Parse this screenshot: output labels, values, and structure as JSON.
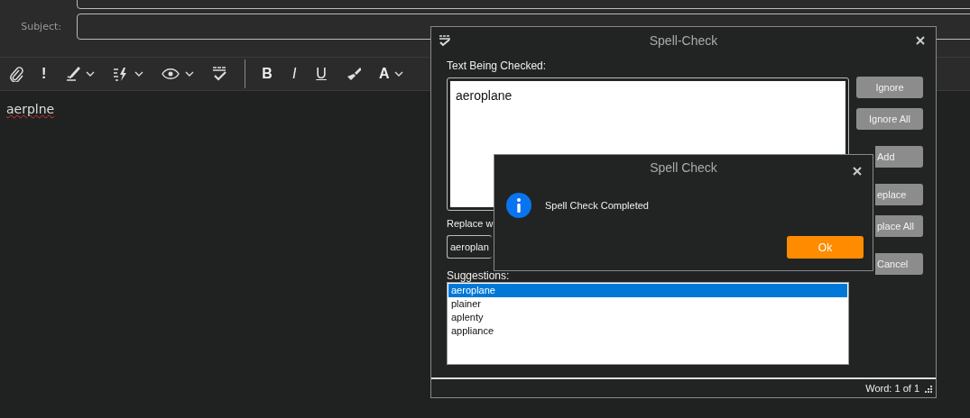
{
  "compose": {
    "subject_label": "Subject:",
    "toolbar": {
      "important": "!",
      "bold": "B",
      "italic": "I",
      "underline": "U",
      "font_color": "A"
    },
    "body_text": "aerplne",
    "body_misspelled": true
  },
  "spell_dialog": {
    "title": "Spell-Check",
    "text_label": "Text Being Checked:",
    "text_value": "aeroplane",
    "replace_label": "Replace w",
    "replace_value": "aeroplan",
    "suggestions_label": "Suggestions:",
    "buttons": [
      {
        "label": "Ignore",
        "covered": false
      },
      {
        "label": "Ignore All",
        "covered": false
      },
      {
        "label": "Add",
        "covered": true
      },
      {
        "label": "eplace",
        "covered": true
      },
      {
        "label": "place All",
        "covered": true
      },
      {
        "label": "Cancel",
        "covered": true
      }
    ],
    "suggestions": [
      {
        "text": "aeroplane",
        "selected": true
      },
      {
        "text": "plainer",
        "selected": false
      },
      {
        "text": "aplenty",
        "selected": false
      },
      {
        "text": "appliance",
        "selected": false
      }
    ],
    "status": "Word: 1 of 1"
  },
  "message_box": {
    "title": "Spell Check",
    "message": "Spell Check Completed",
    "ok_label": "Ok"
  }
}
